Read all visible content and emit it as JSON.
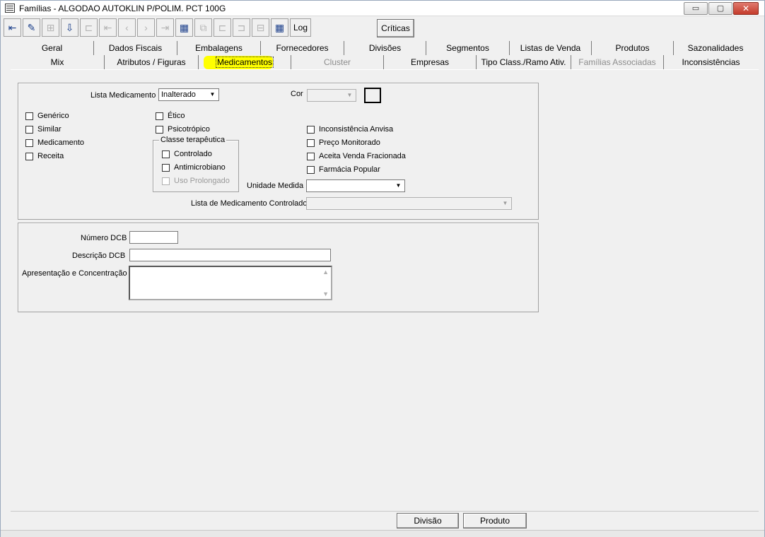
{
  "window": {
    "title": "Famílias - ALGODAO AUTOKLIN P/POLIM. PCT 100G"
  },
  "window_controls": {
    "minimize": "▭",
    "maximize": "▢",
    "close": "✕"
  },
  "toolbar": {
    "buttons": [
      {
        "icon": "exit-icon",
        "glyph": "⇤"
      },
      {
        "icon": "edit-icon",
        "glyph": "✎"
      },
      {
        "icon": "new-record-icon",
        "glyph": "⊞"
      },
      {
        "icon": "save-icon",
        "glyph": "⇩"
      },
      {
        "icon": "record-icon",
        "glyph": "⊏"
      },
      {
        "icon": "first-icon",
        "glyph": "⇤"
      },
      {
        "icon": "prev-icon",
        "glyph": "‹"
      },
      {
        "icon": "next-icon",
        "glyph": "›"
      },
      {
        "icon": "last-icon",
        "glyph": "⇥"
      },
      {
        "icon": "film-icon",
        "glyph": "▦"
      },
      {
        "icon": "link-icon",
        "glyph": "⧉"
      },
      {
        "icon": "copy-record-icon",
        "glyph": "⊏"
      },
      {
        "icon": "paste-record-icon",
        "glyph": "⊐"
      },
      {
        "icon": "delete-record-icon",
        "glyph": "⊟"
      },
      {
        "icon": "grid-icon",
        "glyph": "▦"
      }
    ],
    "log_label": "Log",
    "criticas_label": "Críticas"
  },
  "tabs": {
    "row1": [
      "Geral",
      "Dados Fiscais",
      "Embalagens",
      "Fornecedores",
      "Divisões",
      "Segmentos",
      "Listas de Venda",
      "Produtos",
      "Sazonalidades"
    ],
    "row2": [
      "Mix",
      "Atributos / Figuras",
      "Medicamentos",
      "Cluster",
      "Empresas",
      "Tipo Class./Ramo Ativ.",
      "Famílias Associadas",
      "Inconsistências"
    ]
  },
  "form": {
    "lista_medicamento_label": "Lista Medicamento",
    "lista_medicamento_value": "Inalterado",
    "cor_label": "Cor",
    "cor_value": "",
    "generico": "Genérico",
    "similar": "Similar",
    "medicamento": "Medicamento",
    "receita": "Receita",
    "etico": "Ético",
    "psicotropico": "Psicotrópico",
    "classe_terapeutica": "Classe terapêutica",
    "controlado": "Controlado",
    "antimicrobiano": "Antimicrobiano",
    "uso_prolongado": "Uso Prolongado",
    "inconsistencia_anvisa": "Inconsistência Anvisa",
    "preco_monitorado": "Preço Monitorado",
    "aceita_venda_fracionada": "Aceita Venda Fracionada",
    "farmacia_popular": "Farmácia Popular",
    "unidade_medida_label": "Unidade Medida",
    "unidade_medida_value": "",
    "lista_controlado_label": "Lista de Medicamento Controlado",
    "lista_controlado_value": "",
    "numero_dcb_label": "Número DCB",
    "descricao_dcb_label": "Descrição DCB",
    "apresentacao_label": "Apresentação e Concentração"
  },
  "bottom": {
    "divisao": "Divisão",
    "produto": "Produto"
  }
}
